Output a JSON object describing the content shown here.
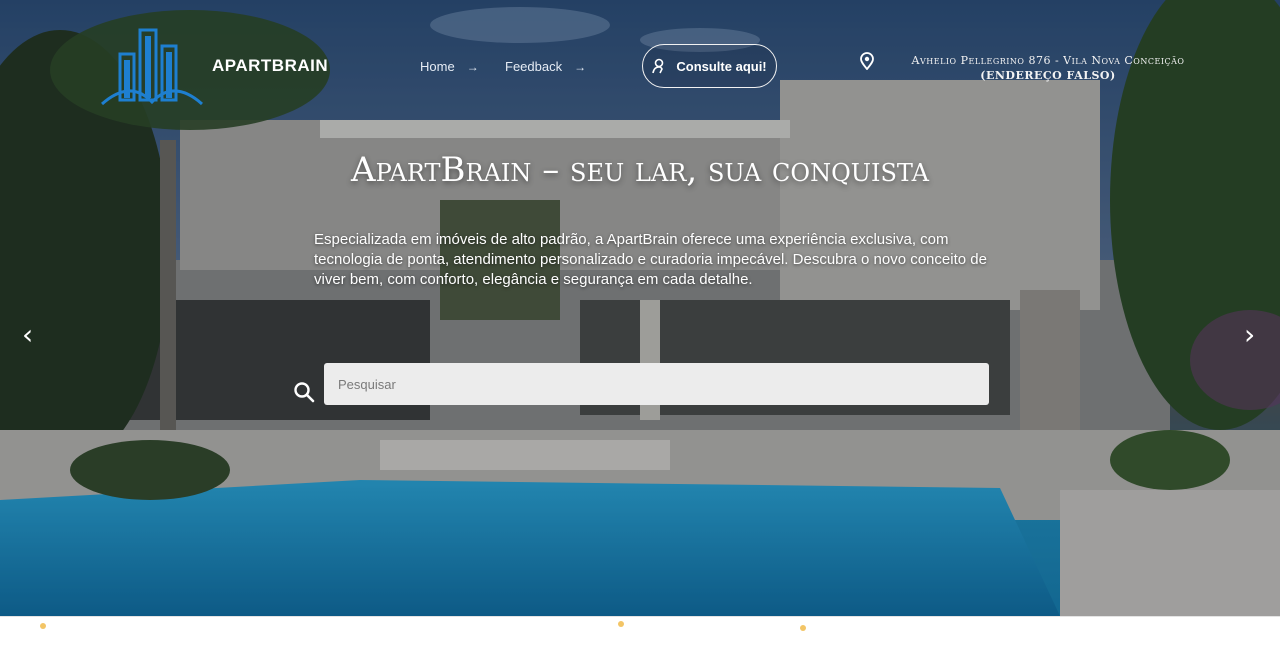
{
  "header": {
    "brand": "APARTBRAIN",
    "nav": [
      {
        "label": "Home",
        "arrow": "→"
      },
      {
        "label": "Feedback",
        "arrow": "→"
      }
    ],
    "cta_label": "Consulte aqui!",
    "address_line1": "Avhelio Pellegrino 876 - Vila Nova Conceição",
    "address_line2": "(ENDEREÇO FALSO)"
  },
  "hero": {
    "headline": "ApartBrain – seu lar, sua conquista",
    "description": "Especializada em imóveis de alto padrão, a ApartBrain oferece uma experiência exclusiva, com tecnologia de ponta, atendimento personalizado e curadoria impecável. Descubra o novo conceito de viver bem, com conforto, elegância e segurança em cada detalhe.",
    "prev_glyph": "‹",
    "next_glyph": "›"
  },
  "search": {
    "placeholder": "Pesquisar",
    "value": ""
  },
  "colors": {
    "pool": "#1f8fbf",
    "sky": "#26486f",
    "logo_blue": "#1e7fd0"
  },
  "icons": {
    "logo": "building-logo-icon",
    "location": "map-pin-icon",
    "user": "user-icon",
    "search": "search-icon",
    "prev": "chevron-left-icon",
    "next": "chevron-right-icon"
  }
}
